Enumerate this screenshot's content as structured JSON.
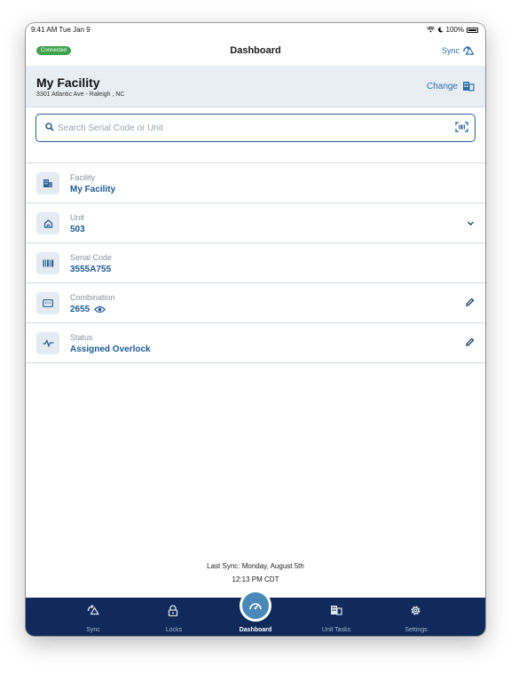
{
  "status_bar": {
    "time": "9:41 AM  Tue Jan 9",
    "battery": "100%"
  },
  "nav": {
    "badge": "Connected",
    "title": "Dashboard",
    "sync_label": "Sync"
  },
  "facility": {
    "name": "My Facility",
    "address": "3301 Atlantic Ave - Raleigh , NC",
    "change_label": "Change"
  },
  "search": {
    "placeholder": "Search Serial Code or Unit",
    "value": ""
  },
  "rows": [
    {
      "label": "Facility",
      "value": "My Facility",
      "icon": "building-icon"
    },
    {
      "label": "Unit",
      "value": "503",
      "icon": "home-icon",
      "action": "chevron-down-icon"
    },
    {
      "label": "Serial Code",
      "value": "3555A755",
      "icon": "barcode-icon"
    },
    {
      "label": "Combination",
      "value": "2655",
      "icon": "keypad-icon",
      "action": "pencil-icon"
    },
    {
      "label": "Status",
      "value": "Assigned Overlock",
      "icon": "activity-icon",
      "action": "pencil-icon"
    }
  ],
  "last_sync": {
    "line1": "Last Sync: Monday, August 5th",
    "line2": "12:13 PM CDT"
  },
  "tabs": [
    {
      "label": "Sync",
      "icon": "sync-icon"
    },
    {
      "label": "Locks",
      "icon": "lock-icon"
    },
    {
      "label": "Dashboard",
      "icon": "gauge-icon",
      "active": true
    },
    {
      "label": "Unit Tasks",
      "icon": "building-icon"
    },
    {
      "label": "Settings",
      "icon": "gear-icon"
    }
  ],
  "colors": {
    "accent": "#2d6ca8",
    "value": "#1d5a93",
    "tab_bar": "#0f2a5b",
    "connected": "#3fa34d"
  }
}
